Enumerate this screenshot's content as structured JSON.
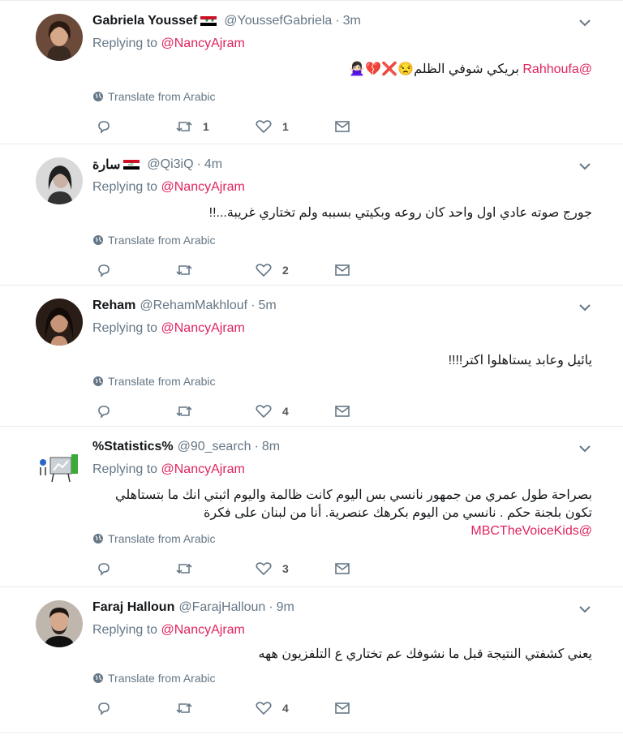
{
  "translate_label": "Translate from Arabic",
  "replying_prefix": "Replying to",
  "colors": {
    "mention": "#e0245e",
    "secondary": "#657786",
    "divider": "#e6ecf0"
  },
  "tweets": [
    {
      "name": "Gabriela Youssef",
      "flag": "syria-flag",
      "handle": "@YoussefGabriela",
      "time": "3m",
      "replying_to": "@NancyAjram",
      "text_mention": "@Rahhoufa",
      "text": "بريكي شوفي الظلم😒❌💔🙅🏻‍♀️",
      "reply_count": "",
      "retweet_count": "1",
      "like_count": "1"
    },
    {
      "name": "سارة",
      "flag": "iraq-flag",
      "handle": "@Qi3iQ",
      "time": "4m",
      "replying_to": "@NancyAjram",
      "text": "جورج صوته عادي اول واحد كان روعه وبكيتي بسببه ولم تختاري غريبة...!!",
      "reply_count": "",
      "retweet_count": "",
      "like_count": "2"
    },
    {
      "name": "Reham",
      "handle": "@RehamMakhlouf",
      "time": "5m",
      "replying_to": "@NancyAjram",
      "text": "يائيل وعابد يستاهلوا اكتر!!!!",
      "reply_count": "",
      "retweet_count": "",
      "like_count": "4"
    },
    {
      "name": "%Statistics%",
      "handle": "@90_search",
      "time": "8m",
      "replying_to": "@NancyAjram",
      "text": "بصراحة طول عمري من جمهور نانسي بس اليوم كانت ظالمة واليوم اثبتي انك ما بتستاهلي تكون بلجنة حكم . نانسي من اليوم بكرهك عنصرية. أنا من لبنان على فكرة",
      "text_mention_end": "@MBCTheVoiceKids",
      "reply_count": "",
      "retweet_count": "",
      "like_count": "3"
    },
    {
      "name": "Faraj Halloun",
      "handle": "@FarajHalloun",
      "time": "9m",
      "replying_to": "@NancyAjram",
      "text": "يعني كشفتي النتيجة قبل ما نشوفك عم تختاري ع التلفزيون ههه",
      "reply_count": "",
      "retweet_count": "",
      "like_count": "4"
    }
  ]
}
